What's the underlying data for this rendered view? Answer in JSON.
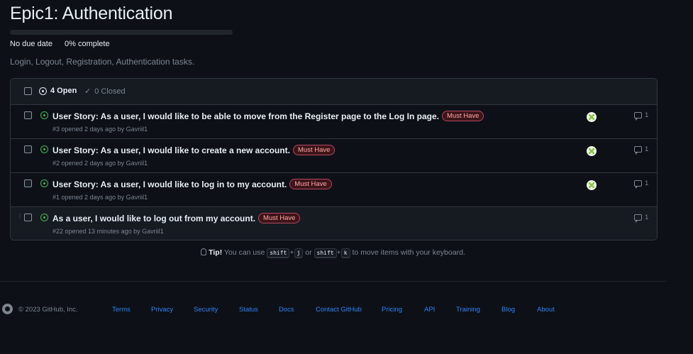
{
  "milestone": {
    "title": "Epic1: Authentication",
    "progress_fraction": 0.0,
    "due": "No due date",
    "complete": "0% complete",
    "description": "Login, Logout, Registration, Authentication tasks."
  },
  "list_header": {
    "open_label": "4 Open",
    "closed_label": "0 Closed"
  },
  "issues": [
    {
      "title": "User Story: As a user, I would like to be able to move from the Register page to the Log In page.",
      "label": "Must Have",
      "subtitle": "#3 opened 2 days ago by Gavriil1",
      "comments": "1",
      "assignee_avatar": true
    },
    {
      "title": "User Story: As a user, I would like to create a new account.",
      "label": "Must Have",
      "subtitle": "#2 opened 2 days ago by Gavriil1",
      "comments": "1",
      "assignee_avatar": true
    },
    {
      "title": "User Story: As a user, I would like to log in to my account.",
      "label": "Must Have",
      "subtitle": "#1 opened 2 days ago by Gavriil1",
      "comments": "1",
      "assignee_avatar": true
    },
    {
      "title": "As a user, I would like to log out from my account.",
      "label": "Must Have",
      "subtitle": "#22 opened 13 minutes ago by Gavriil1",
      "comments": "1",
      "assignee_avatar": false
    }
  ],
  "tip": {
    "bold": "Tip!",
    "t1": "You can use",
    "k1": "shift",
    "plus": "+",
    "k2": "j",
    "or": "or",
    "k3": "shift",
    "k4": "k",
    "t2": "to move items with your keyboard."
  },
  "footer": {
    "copyright": "© 2023 GitHub, Inc.",
    "links": [
      "Terms",
      "Privacy",
      "Security",
      "Status",
      "Docs",
      "Contact GitHub",
      "Pricing",
      "API",
      "Training",
      "Blog",
      "About"
    ]
  },
  "colors": {
    "background": "#0d1117",
    "link": "#2f81f7",
    "open_green": "#3fb950",
    "label_red": "#b3485d"
  },
  "icons": [
    "issue-opened-icon",
    "check-icon",
    "comment-icon",
    "github-logo-icon",
    "light-bulb-icon",
    "grabber-icon"
  ]
}
